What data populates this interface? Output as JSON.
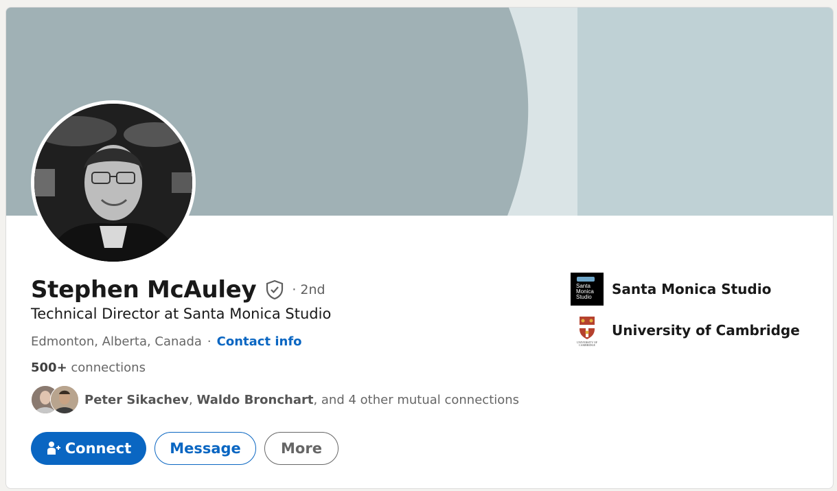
{
  "profile": {
    "name": "Stephen McAuley",
    "degree": "· 2nd",
    "headline": "Technical Director at Santa Monica Studio",
    "location": "Edmonton, Alberta, Canada",
    "separator": "·",
    "contact_info_label": "Contact info",
    "connections_count": "500+",
    "connections_label": "connections"
  },
  "mutual": {
    "name1": "Peter Sikachev",
    "comma": ",",
    "name2": "Waldo Bronchart",
    "rest": ", and 4 other mutual connections"
  },
  "actions": {
    "connect_label": "Connect",
    "message_label": "Message",
    "more_label": "More"
  },
  "orgs": [
    {
      "name": "Santa Monica Studio",
      "logo_text": "Santa Monica Studio",
      "icon": "santa-monica-studio-logo"
    },
    {
      "name": "University of Cambridge",
      "logo_text": "UNIVERSITY OF CAMBRIDGE",
      "icon": "university-of-cambridge-logo"
    }
  ],
  "colors": {
    "primary": "#0a66c2",
    "banner_left": "#a0b1b5",
    "banner_mid": "#dae4e6",
    "banner_right": "#bfd1d5"
  }
}
